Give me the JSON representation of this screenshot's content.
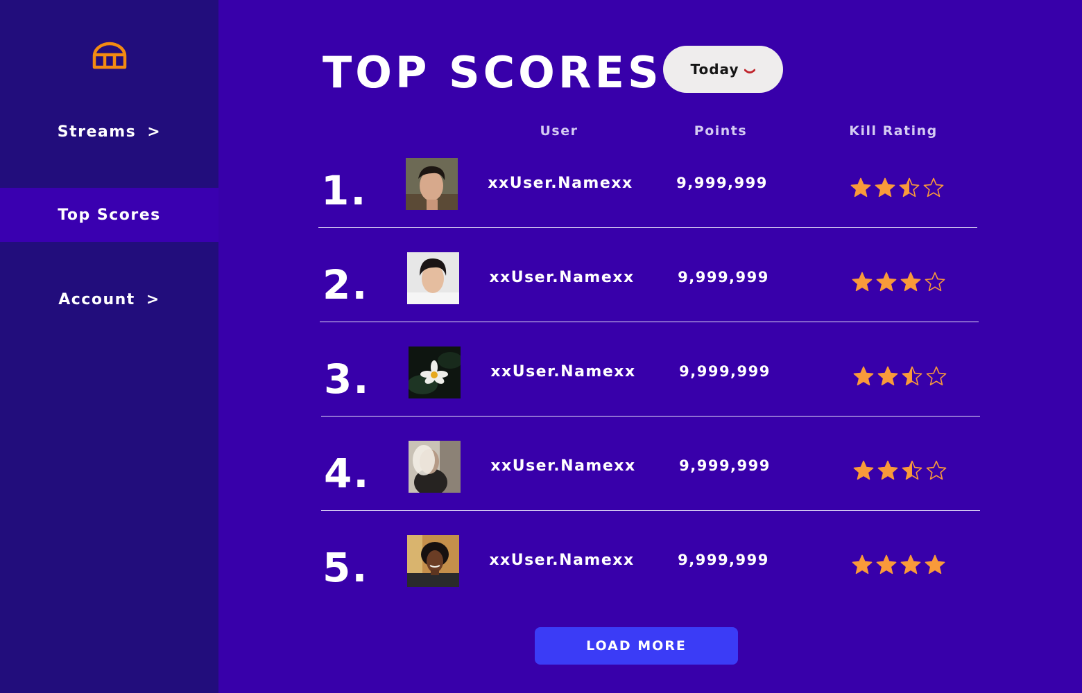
{
  "sidebar": {
    "logo_icon": "stadium-icon",
    "items": [
      {
        "label": "Streams",
        "chevron": ">"
      },
      {
        "label": "Top Scores",
        "chevron": ""
      },
      {
        "label": "Account",
        "chevron": ">"
      }
    ],
    "active_item": "Top Scores"
  },
  "header": {
    "title": "TOP SCORES",
    "filter": {
      "selected": "Today",
      "icon": "chevron-down-icon"
    }
  },
  "table": {
    "columns": {
      "user": "User",
      "points": "Points",
      "rating": "Kill Rating"
    },
    "rows": [
      {
        "rank": "1.",
        "user": "xxUser.Namexx",
        "points": "9,999,999",
        "rating": 2.5,
        "max_rating": 4
      },
      {
        "rank": "2.",
        "user": "xxUser.Namexx",
        "points": "9,999,999",
        "rating": 3,
        "max_rating": 4
      },
      {
        "rank": "3.",
        "user": "xxUser.Namexx",
        "points": "9,999,999",
        "rating": 2.5,
        "max_rating": 4
      },
      {
        "rank": "4.",
        "user": "xxUser.Namexx",
        "points": "9,999,999",
        "rating": 2.5,
        "max_rating": 4
      },
      {
        "rank": "5.",
        "user": "xxUser.Namexx",
        "points": "9,999,999",
        "rating": 4,
        "max_rating": 4
      }
    ]
  },
  "load_more": "LOAD MORE",
  "colors": {
    "background": "#3800aa",
    "sidebar": "#220d7c",
    "sidebar_active": "#3a00b0",
    "accent_star": "#f99a3a",
    "logo": "#f38b12",
    "button": "#3b3cf6",
    "caret": "#c0242b"
  }
}
